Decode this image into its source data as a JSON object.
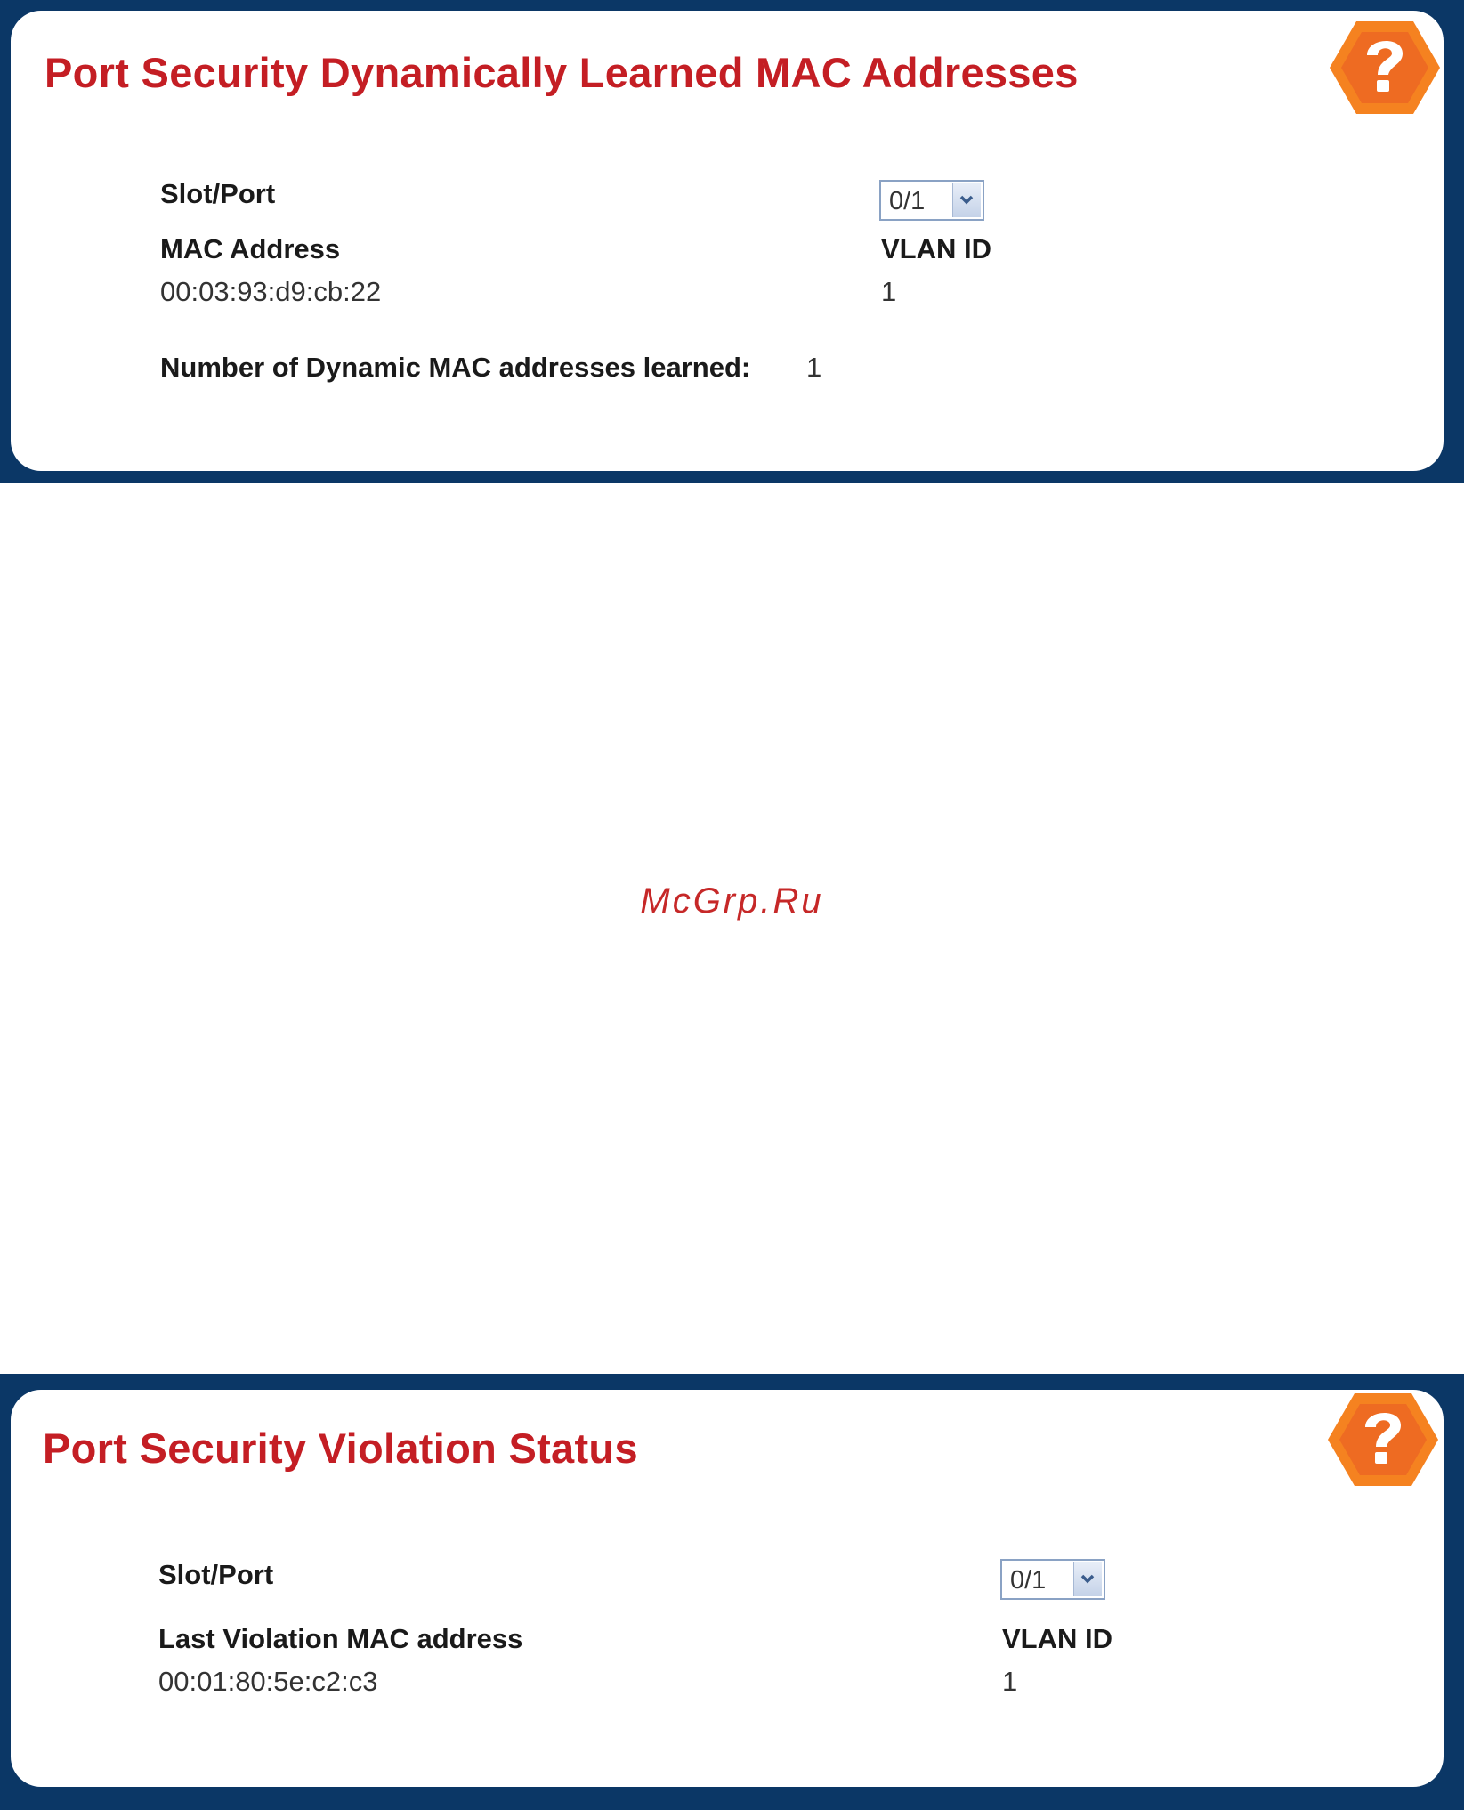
{
  "mac_panel": {
    "title": "Port Security Dynamically Learned MAC Addresses",
    "slot_port_label": "Slot/Port",
    "slot_port_value": "0/1",
    "mac_header": "MAC Address",
    "vlan_header": "VLAN ID",
    "rows": [
      {
        "mac": "00:03:93:d9:cb:22",
        "vlan": "1"
      }
    ],
    "count_label": "Number of Dynamic MAC addresses learned:",
    "count_value": "1"
  },
  "watermark": "McGrp.Ru",
  "violation_panel": {
    "title": "Port Security Violation Status",
    "slot_port_label": "Slot/Port",
    "slot_port_value": "0/1",
    "mac_header": "Last Violation MAC address",
    "vlan_header": "VLAN ID",
    "rows": [
      {
        "mac": "00:01:80:5e:c2:c3",
        "vlan": "1"
      }
    ]
  },
  "colors": {
    "frame": "#0b3766",
    "title": "#c41e24",
    "help_outer": "#f58220",
    "help_inner": "#ec6a1c"
  },
  "icons": [
    "help-icon",
    "chevron-down-icon"
  ]
}
